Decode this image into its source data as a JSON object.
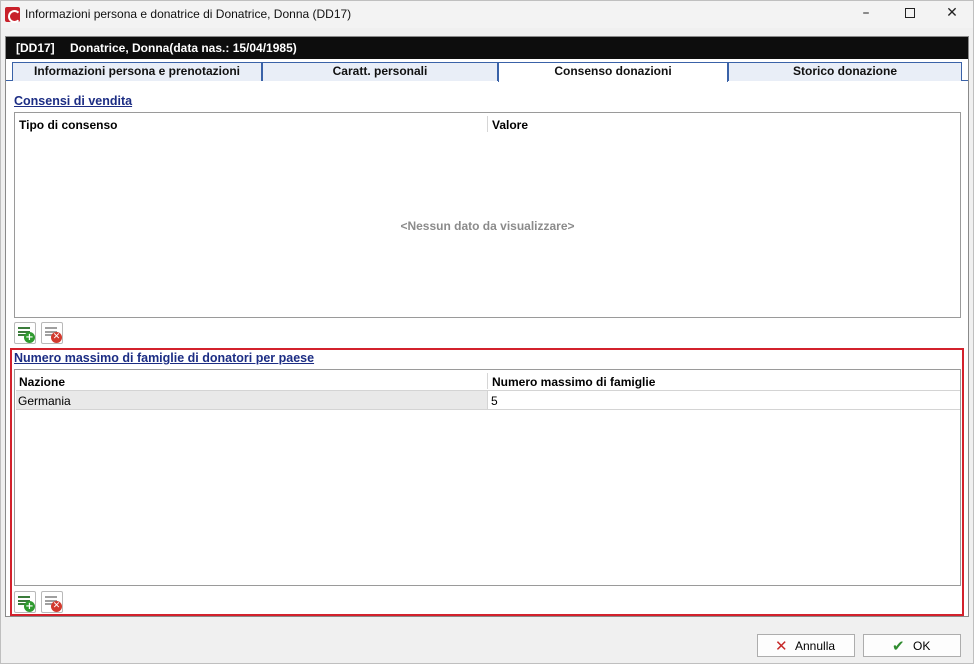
{
  "window": {
    "title": "Informazioni persona e donatrice di Donatrice, Donna (DD17)",
    "controls": {
      "minimize": "–",
      "close": "✕"
    }
  },
  "header": {
    "code": "[DD17]",
    "name": "Donatrice, Donna(data nas.: 15/04/1985)"
  },
  "tabs": [
    {
      "label": "Informazioni persona e prenotazioni",
      "active": false
    },
    {
      "label": "Caratt. personali",
      "active": false
    },
    {
      "label": "Consenso donazioni",
      "active": true
    },
    {
      "label": "Storico donazione",
      "active": false
    }
  ],
  "consensi": {
    "title": "Consensi di vendita",
    "columns": [
      "Tipo di consenso",
      "Valore"
    ],
    "empty_message": "<Nessun dato da visualizzare>",
    "rows": []
  },
  "famiglie": {
    "title": "Numero massimo di famiglie di donatori per paese",
    "columns": [
      "Nazione",
      "Numero massimo di famiglie"
    ],
    "rows": [
      {
        "nazione": "Germania",
        "numero": "5"
      }
    ]
  },
  "icons": {
    "add": "add-row-icon",
    "delete": "delete-row-icon"
  },
  "footer": {
    "cancel_label": "Annulla",
    "ok_label": "OK"
  },
  "colors": {
    "header_bg": "#0d0d0d",
    "section_title": "#1c2d84",
    "highlight_border": "#d3212c",
    "tab_border": "#3a62a8"
  }
}
